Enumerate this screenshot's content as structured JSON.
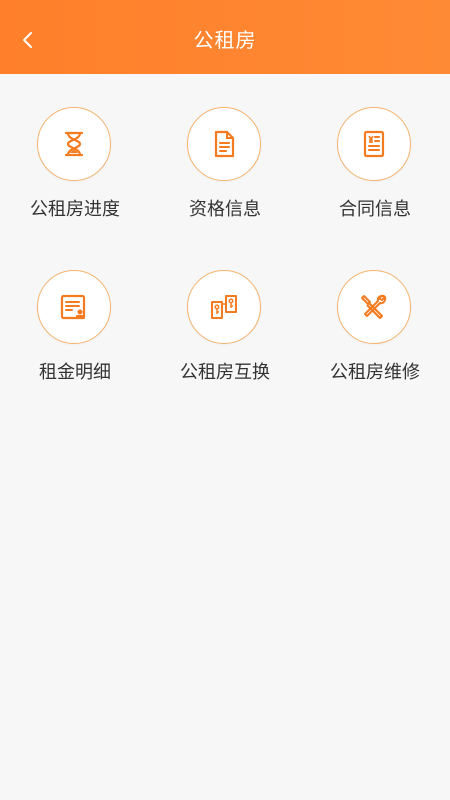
{
  "header": {
    "title": "公租房",
    "back_icon": "chevron-left-icon",
    "background_color": "#ff7f2a"
  },
  "accent_color": "#f47b20",
  "menu": [
    {
      "id": "progress",
      "label": "公租房进度",
      "icon": "hourglass-icon"
    },
    {
      "id": "qualification",
      "label": "资格信息",
      "icon": "document-icon"
    },
    {
      "id": "contract",
      "label": "合同信息",
      "icon": "contract-yen-icon"
    },
    {
      "id": "rent",
      "label": "租金明细",
      "icon": "rent-statement-icon"
    },
    {
      "id": "exchange",
      "label": "公租房互换",
      "icon": "exchange-keys-icon"
    },
    {
      "id": "repair",
      "label": "公租房维修",
      "icon": "tools-icon"
    }
  ]
}
